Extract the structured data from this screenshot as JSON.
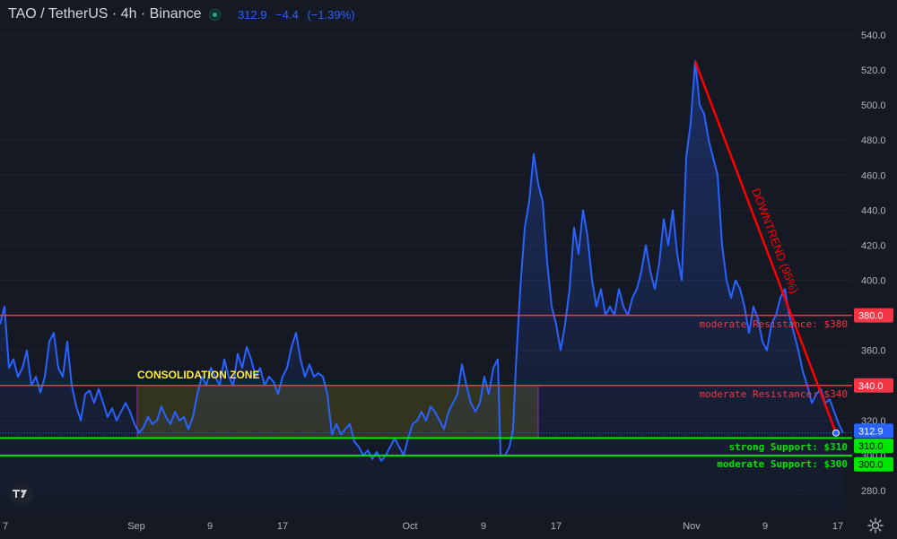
{
  "header": {
    "symbol": "TAO / TetherUS · 4h · Binance",
    "price": "312.9",
    "change": "−4.4",
    "change_pct": "(−1.39%)"
  },
  "colors": {
    "background": "#151924",
    "price_line": "#2962ff",
    "resistance": "#f23645",
    "support": "#00e600",
    "consolidation_fill": "#3d3d1e",
    "consolidation_border": "#9c27b0",
    "label_yellow": "#ffeb3b",
    "axis_text": "#b2b5be"
  },
  "chart_data": {
    "type": "line",
    "x_tick_labels": [
      "7",
      "Sep",
      "9",
      "17",
      "Oct",
      "9",
      "17",
      "Nov",
      "9",
      "17"
    ],
    "y_ticks": [
      280.0,
      300.0,
      320.0,
      340.0,
      360.0,
      380.0,
      400.0,
      420.0,
      440.0,
      460.0,
      480.0,
      500.0,
      520.0,
      540.0
    ],
    "ylim": [
      272,
      550
    ],
    "current_price": 312.9,
    "current_price_label": "312.9",
    "price_series": [
      [
        0,
        375
      ],
      [
        5,
        385
      ],
      [
        10,
        350
      ],
      [
        15,
        355
      ],
      [
        20,
        345
      ],
      [
        25,
        350
      ],
      [
        30,
        360
      ],
      [
        35,
        340
      ],
      [
        40,
        345
      ],
      [
        45,
        336
      ],
      [
        50,
        345
      ],
      [
        55,
        365
      ],
      [
        60,
        370
      ],
      [
        65,
        350
      ],
      [
        70,
        345
      ],
      [
        75,
        365
      ],
      [
        80,
        340
      ],
      [
        85,
        328
      ],
      [
        90,
        320
      ],
      [
        95,
        335
      ],
      [
        100,
        337
      ],
      [
        105,
        330
      ],
      [
        110,
        338
      ],
      [
        115,
        330
      ],
      [
        120,
        322
      ],
      [
        125,
        327
      ],
      [
        130,
        320
      ],
      [
        135,
        325
      ],
      [
        140,
        330
      ],
      [
        145,
        325
      ],
      [
        150,
        318
      ],
      [
        155,
        313
      ],
      [
        160,
        316
      ],
      [
        165,
        322
      ],
      [
        170,
        318
      ],
      [
        175,
        320
      ],
      [
        180,
        328
      ],
      [
        185,
        322
      ],
      [
        190,
        318
      ],
      [
        195,
        325
      ],
      [
        200,
        320
      ],
      [
        205,
        322
      ],
      [
        210,
        315
      ],
      [
        215,
        322
      ],
      [
        220,
        335
      ],
      [
        225,
        345
      ],
      [
        230,
        340
      ],
      [
        235,
        350
      ],
      [
        240,
        345
      ],
      [
        245,
        340
      ],
      [
        250,
        355
      ],
      [
        255,
        345
      ],
      [
        260,
        340
      ],
      [
        265,
        358
      ],
      [
        270,
        350
      ],
      [
        275,
        362
      ],
      [
        280,
        355
      ],
      [
        285,
        345
      ],
      [
        290,
        350
      ],
      [
        295,
        340
      ],
      [
        300,
        345
      ],
      [
        305,
        342
      ],
      [
        310,
        335
      ],
      [
        315,
        345
      ],
      [
        320,
        350
      ],
      [
        325,
        362
      ],
      [
        330,
        370
      ],
      [
        335,
        355
      ],
      [
        340,
        345
      ],
      [
        345,
        352
      ],
      [
        350,
        345
      ],
      [
        355,
        347
      ],
      [
        360,
        345
      ],
      [
        365,
        335
      ],
      [
        370,
        312
      ],
      [
        375,
        318
      ],
      [
        380,
        312
      ],
      [
        385,
        315
      ],
      [
        390,
        318
      ],
      [
        395,
        308
      ],
      [
        400,
        305
      ],
      [
        405,
        300
      ],
      [
        410,
        303
      ],
      [
        415,
        298
      ],
      [
        420,
        302
      ],
      [
        425,
        297
      ],
      [
        430,
        300
      ],
      [
        435,
        305
      ],
      [
        440,
        310
      ],
      [
        445,
        305
      ],
      [
        450,
        300
      ],
      [
        455,
        310
      ],
      [
        460,
        318
      ],
      [
        465,
        320
      ],
      [
        470,
        325
      ],
      [
        475,
        320
      ],
      [
        480,
        328
      ],
      [
        485,
        325
      ],
      [
        490,
        320
      ],
      [
        495,
        315
      ],
      [
        500,
        325
      ],
      [
        505,
        330
      ],
      [
        510,
        335
      ],
      [
        515,
        352
      ],
      [
        520,
        340
      ],
      [
        525,
        330
      ],
      [
        530,
        325
      ],
      [
        535,
        330
      ],
      [
        540,
        345
      ],
      [
        545,
        335
      ],
      [
        550,
        350
      ],
      [
        555,
        355
      ],
      [
        558,
        300
      ],
      [
        563,
        300
      ],
      [
        568,
        305
      ],
      [
        572,
        315
      ],
      [
        575,
        350
      ],
      [
        580,
        395
      ],
      [
        585,
        430
      ],
      [
        590,
        445
      ],
      [
        595,
        472
      ],
      [
        600,
        455
      ],
      [
        605,
        445
      ],
      [
        610,
        410
      ],
      [
        615,
        385
      ],
      [
        620,
        375
      ],
      [
        625,
        360
      ],
      [
        630,
        375
      ],
      [
        635,
        395
      ],
      [
        640,
        430
      ],
      [
        645,
        415
      ],
      [
        650,
        440
      ],
      [
        655,
        425
      ],
      [
        660,
        400
      ],
      [
        665,
        385
      ],
      [
        670,
        395
      ],
      [
        675,
        380
      ],
      [
        680,
        385
      ],
      [
        685,
        380
      ],
      [
        690,
        395
      ],
      [
        695,
        385
      ],
      [
        700,
        380
      ],
      [
        705,
        390
      ],
      [
        710,
        395
      ],
      [
        715,
        405
      ],
      [
        720,
        420
      ],
      [
        725,
        405
      ],
      [
        730,
        395
      ],
      [
        735,
        410
      ],
      [
        740,
        435
      ],
      [
        745,
        420
      ],
      [
        750,
        440
      ],
      [
        755,
        415
      ],
      [
        760,
        400
      ],
      [
        765,
        470
      ],
      [
        770,
        490
      ],
      [
        775,
        525
      ],
      [
        780,
        500
      ],
      [
        785,
        495
      ],
      [
        790,
        480
      ],
      [
        795,
        470
      ],
      [
        800,
        460
      ],
      [
        805,
        420
      ],
      [
        810,
        400
      ],
      [
        815,
        390
      ],
      [
        820,
        400
      ],
      [
        825,
        395
      ],
      [
        830,
        385
      ],
      [
        835,
        370
      ],
      [
        840,
        385
      ],
      [
        845,
        378
      ],
      [
        850,
        365
      ],
      [
        855,
        360
      ],
      [
        860,
        375
      ],
      [
        865,
        380
      ],
      [
        870,
        390
      ],
      [
        875,
        395
      ],
      [
        880,
        380
      ],
      [
        885,
        370
      ],
      [
        890,
        360
      ],
      [
        895,
        348
      ],
      [
        900,
        340
      ],
      [
        905,
        330
      ],
      [
        910,
        335
      ],
      [
        915,
        338
      ],
      [
        920,
        330
      ],
      [
        925,
        332
      ],
      [
        930,
        325
      ],
      [
        935,
        318
      ],
      [
        940,
        312.9
      ]
    ],
    "annotations": {
      "resistance_380_label": "moderate Resistance: $380",
      "resistance_340_label": "moderate Resistance: $340",
      "support_310_label": "strong Support: $310",
      "support_300_label": "moderate Support: $300",
      "consolidation_label": "CONSOLIDATION ZONE",
      "downtrend_label": "DOWNTREND (95%)",
      "axis_380": "380.0",
      "axis_340": "340.0",
      "axis_310": "310.0",
      "axis_300": "300.0"
    },
    "levels": {
      "resistance": [
        380,
        340
      ],
      "support": [
        310,
        300
      ]
    },
    "consolidation_zone": {
      "y_top": 340,
      "y_bottom": 310
    },
    "downtrend": {
      "from": 525,
      "to": 312.9
    }
  },
  "icons": {
    "settings": "gear-icon",
    "logo": "tradingview-logo-icon",
    "status": "market-open-dot-icon"
  }
}
